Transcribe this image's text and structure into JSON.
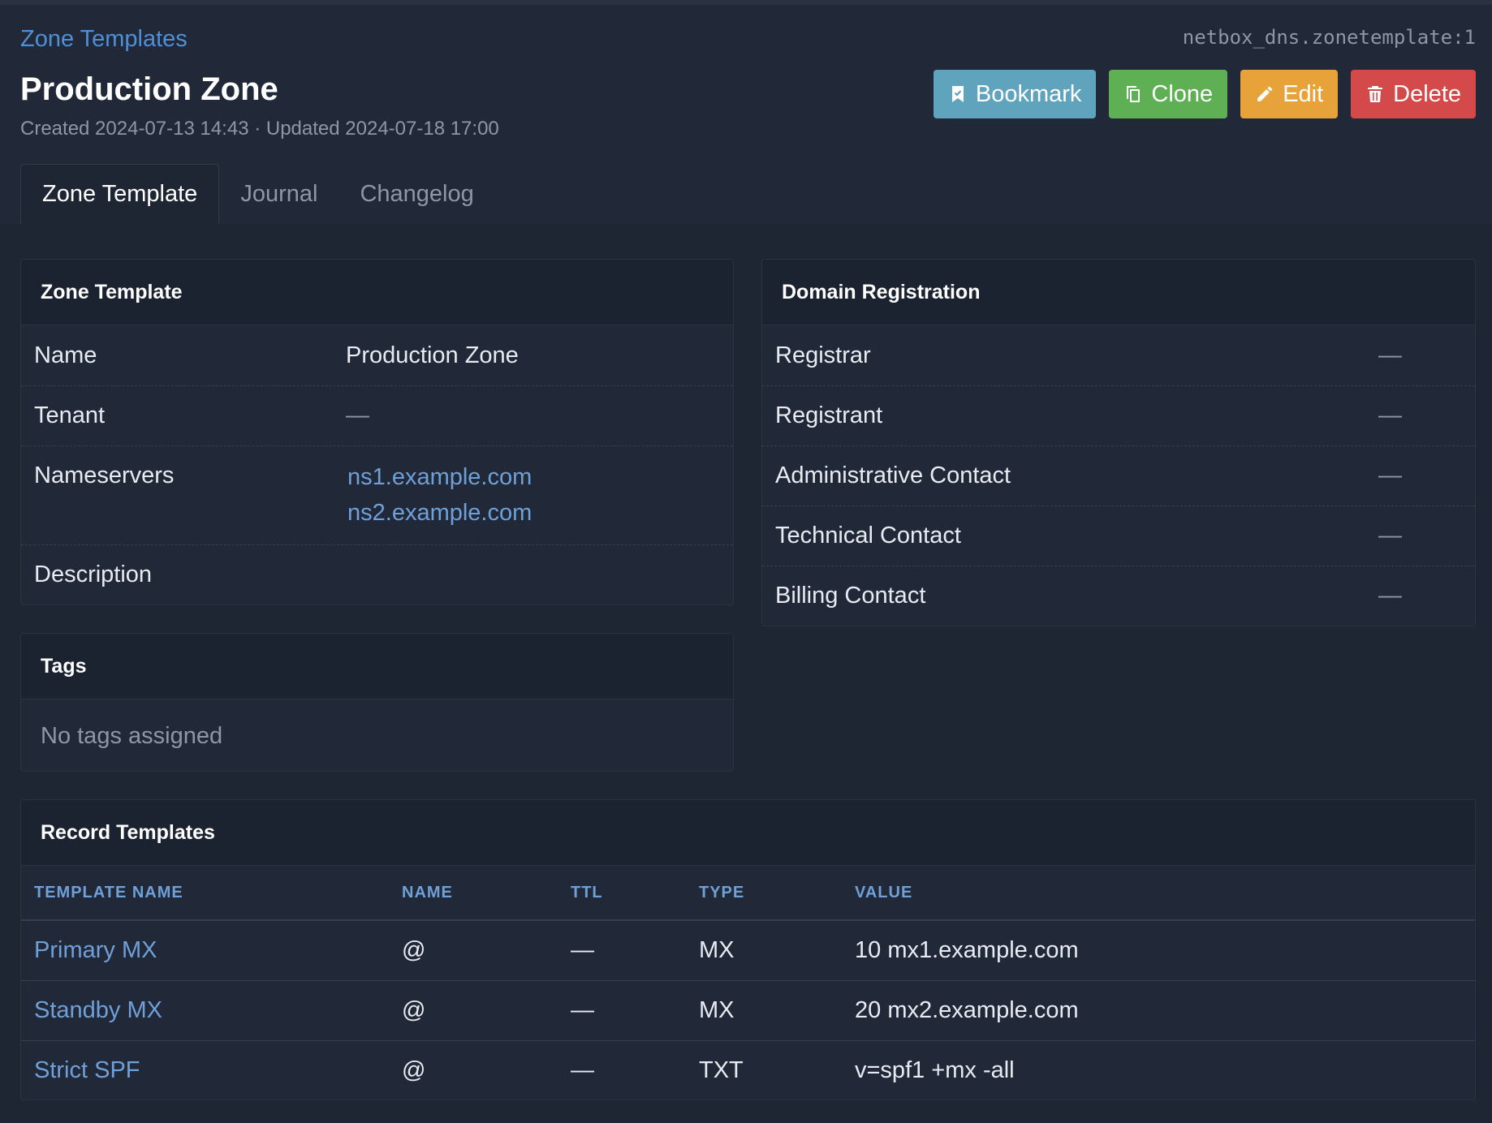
{
  "breadcrumb": "Zone Templates",
  "object_id": "netbox_dns.zonetemplate:1",
  "title": "Production Zone",
  "meta": "Created 2024-07-13 14:43 · Updated 2024-07-18 17:00",
  "actions": {
    "bookmark": "Bookmark",
    "clone": "Clone",
    "edit": "Edit",
    "delete": "Delete"
  },
  "tabs": [
    "Zone Template",
    "Journal",
    "Changelog"
  ],
  "zone_template": {
    "header": "Zone Template",
    "rows": {
      "name": {
        "label": "Name",
        "value": "Production Zone"
      },
      "tenant": {
        "label": "Tenant",
        "value": "—"
      },
      "nameservers": {
        "label": "Nameservers",
        "values": [
          "ns1.example.com",
          "ns2.example.com"
        ]
      },
      "description": {
        "label": "Description",
        "value": ""
      }
    }
  },
  "tags": {
    "header": "Tags",
    "empty": "No tags assigned"
  },
  "domain_registration": {
    "header": "Domain Registration",
    "rows": [
      {
        "label": "Registrar",
        "value": "—"
      },
      {
        "label": "Registrant",
        "value": "—"
      },
      {
        "label": "Administrative Contact",
        "value": "—"
      },
      {
        "label": "Technical Contact",
        "value": "—"
      },
      {
        "label": "Billing Contact",
        "value": "—"
      }
    ]
  },
  "record_templates": {
    "header": "Record Templates",
    "columns": [
      "TEMPLATE NAME",
      "NAME",
      "TTL",
      "TYPE",
      "VALUE"
    ],
    "rows": [
      {
        "template_name": "Primary MX",
        "name": "@",
        "ttl": "—",
        "type": "MX",
        "value": "10 mx1.example.com"
      },
      {
        "template_name": "Standby MX",
        "name": "@",
        "ttl": "—",
        "type": "MX",
        "value": "20 mx2.example.com"
      },
      {
        "template_name": "Strict SPF",
        "name": "@",
        "ttl": "—",
        "type": "TXT",
        "value": "v=spf1 +mx -all"
      }
    ]
  },
  "colors": {
    "page_bg": "#1f2633",
    "card_bg": "#212938",
    "link": "#6fa0d8",
    "bookmark": "#5fa3bd",
    "clone": "#5fb055",
    "edit": "#e8a23a",
    "delete": "#d44a4a"
  }
}
